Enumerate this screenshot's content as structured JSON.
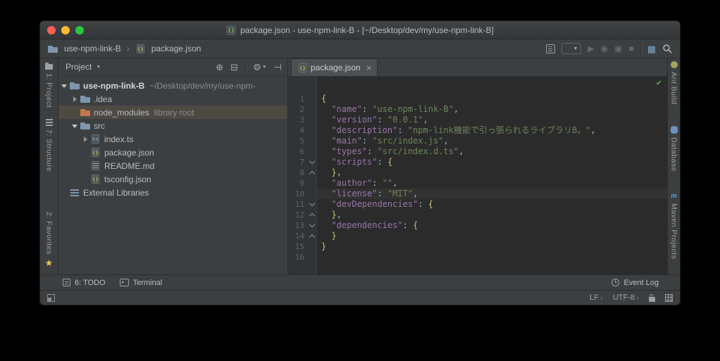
{
  "window": {
    "title": "package.json - use-npm-link-B - [~/Desktop/dev/my/use-npm-link-B]"
  },
  "navbar": {
    "breadcrumb_project": "use-npm-link-B",
    "breadcrumb_file": "package.json"
  },
  "left_stripe": {
    "project": "1: Project",
    "structure": "7: Structure",
    "favorites": "2: Favorites"
  },
  "right_stripe": {
    "ant": "Ant Build",
    "database": "Database",
    "maven": "Maven Projects"
  },
  "project_panel": {
    "title": "Project",
    "tree": [
      {
        "depth": 0,
        "arrow": "expanded",
        "icon": "folder",
        "name": "use-npm-link-B",
        "suffix": "~/Desktop/dev/my/use-npm-",
        "bold": true
      },
      {
        "depth": 1,
        "arrow": "collapsed",
        "icon": "folder",
        "name": ".idea"
      },
      {
        "depth": 1,
        "arrow": "none",
        "icon": "folder-excluded",
        "name": "node_modules",
        "suffix": "library root",
        "selected": true
      },
      {
        "depth": 1,
        "arrow": "expanded",
        "icon": "folder",
        "name": "src"
      },
      {
        "depth": 2,
        "arrow": "collapsed",
        "icon": "file-ts",
        "name": "index.ts"
      },
      {
        "depth": 2,
        "arrow": "none",
        "icon": "file-json",
        "name": "package.json"
      },
      {
        "depth": 2,
        "arrow": "none",
        "icon": "file-md",
        "name": "README.md"
      },
      {
        "depth": 2,
        "arrow": "none",
        "icon": "file-json",
        "name": "tsconfig.json"
      },
      {
        "depth": 0,
        "arrow": "none",
        "icon": "libraries",
        "name": "External Libraries"
      }
    ]
  },
  "editor": {
    "tab": "package.json",
    "lines": [
      {
        "n": 1,
        "tokens": [
          [
            "b",
            "{"
          ]
        ]
      },
      {
        "n": 2,
        "tokens": [
          [
            "p",
            "  "
          ],
          [
            "k",
            "\"name\""
          ],
          [
            "p",
            ": "
          ],
          [
            "s",
            "\"use-npm-link-B\""
          ],
          [
            "p",
            ","
          ]
        ]
      },
      {
        "n": 3,
        "tokens": [
          [
            "p",
            "  "
          ],
          [
            "k",
            "\"version\""
          ],
          [
            "p",
            ": "
          ],
          [
            "s",
            "\"0.0.1\""
          ],
          [
            "p",
            ","
          ]
        ]
      },
      {
        "n": 4,
        "tokens": [
          [
            "p",
            "  "
          ],
          [
            "k",
            "\"description\""
          ],
          [
            "p",
            ": "
          ],
          [
            "s",
            "\"npm-link機能で引っ張られるライブラリB。\""
          ],
          [
            "p",
            ","
          ]
        ]
      },
      {
        "n": 5,
        "tokens": [
          [
            "p",
            "  "
          ],
          [
            "k",
            "\"main\""
          ],
          [
            "p",
            ": "
          ],
          [
            "s",
            "\"src/index.js\""
          ],
          [
            "p",
            ","
          ]
        ]
      },
      {
        "n": 6,
        "tokens": [
          [
            "p",
            "  "
          ],
          [
            "k",
            "\"types\""
          ],
          [
            "p",
            ": "
          ],
          [
            "s",
            "\"src/index.d.ts\""
          ],
          [
            "p",
            ","
          ]
        ]
      },
      {
        "n": 7,
        "fold": "start",
        "tokens": [
          [
            "p",
            "  "
          ],
          [
            "k",
            "\"scripts\""
          ],
          [
            "p",
            ": "
          ],
          [
            "b",
            "{"
          ]
        ]
      },
      {
        "n": 8,
        "fold": "end",
        "tokens": [
          [
            "p",
            "  "
          ],
          [
            "b",
            "}"
          ],
          [
            "p",
            ","
          ]
        ]
      },
      {
        "n": 9,
        "tokens": [
          [
            "p",
            "  "
          ],
          [
            "k",
            "\"author\""
          ],
          [
            "p",
            ": "
          ],
          [
            "s",
            "\"\""
          ],
          [
            "p",
            ","
          ]
        ]
      },
      {
        "n": 10,
        "current": true,
        "tokens": [
          [
            "p",
            "  "
          ],
          [
            "k",
            "\"license\""
          ],
          [
            "p",
            ": "
          ],
          [
            "s",
            "\"MIT\""
          ],
          [
            "p",
            ","
          ]
        ]
      },
      {
        "n": 11,
        "fold": "start",
        "tokens": [
          [
            "p",
            "  "
          ],
          [
            "k",
            "\"devDependencies\""
          ],
          [
            "p",
            ": "
          ],
          [
            "b",
            "{"
          ]
        ]
      },
      {
        "n": 12,
        "fold": "end",
        "tokens": [
          [
            "p",
            "  "
          ],
          [
            "b",
            "}"
          ],
          [
            "p",
            ","
          ]
        ]
      },
      {
        "n": 13,
        "fold": "start",
        "tokens": [
          [
            "p",
            "  "
          ],
          [
            "k",
            "\"dependencies\""
          ],
          [
            "p",
            ": "
          ],
          [
            "b",
            "{"
          ]
        ]
      },
      {
        "n": 14,
        "fold": "end",
        "tokens": [
          [
            "p",
            "  "
          ],
          [
            "b",
            "}"
          ]
        ]
      },
      {
        "n": 15,
        "tokens": [
          [
            "b",
            "}"
          ]
        ]
      },
      {
        "n": 16,
        "tokens": []
      }
    ]
  },
  "bottom_bar": {
    "todo": "6: TODO",
    "terminal": "Terminal",
    "event_log": "Event Log"
  },
  "status_bar": {
    "line_sep": "LF",
    "encoding": "UTF-8"
  },
  "icons": {
    "chevron_down": "▼",
    "breadcrumb_separator": "›",
    "play": "▶",
    "debug": "◉",
    "coverage": "▣",
    "stop": "■",
    "tool_windows": "▦",
    "locate": "⊕",
    "collapse_all": "⊟",
    "settings": "⚙",
    "hide_panel": "⊣",
    "star": "★",
    "updown": "↕",
    "check": "✔",
    "tab_close": "×",
    "maven_m": "m",
    "braces": "{}"
  },
  "colors": {
    "json_key": "#9876aa",
    "json_string": "#6a8759",
    "json_punct": "#a9b7c6",
    "json_brace": "#cdc472",
    "check_green": "#5fb346",
    "selection_bg": "#4d4a43",
    "current_line": "#323232",
    "star_yellow": "#eac549"
  }
}
